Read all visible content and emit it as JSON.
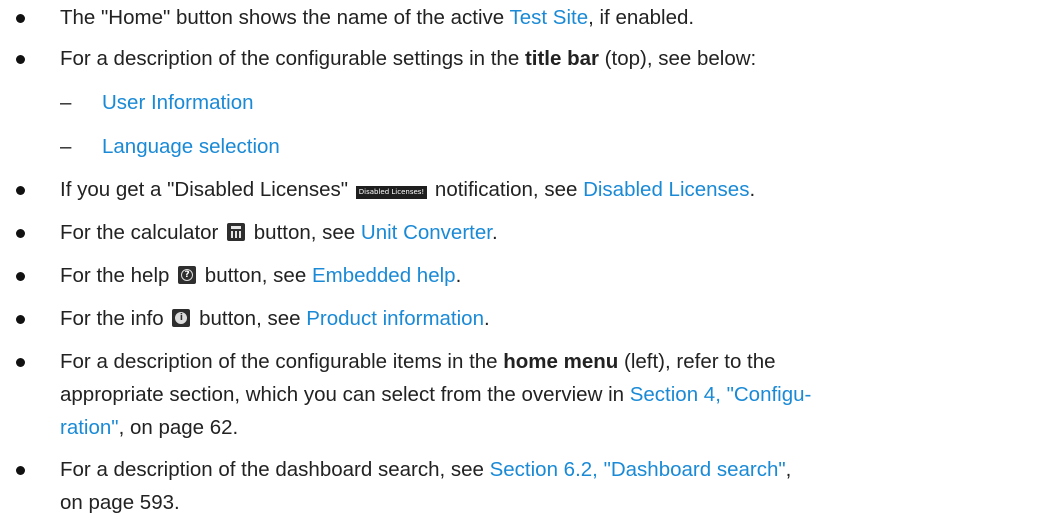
{
  "items": [
    {
      "pre": "The \"Home\" button shows the name of the active ",
      "link": "Test Site",
      "post": ", if enabled."
    },
    {
      "pre": "For a description of the configurable settings in the ",
      "bold": "title bar",
      "post": " (top), see below:"
    },
    {
      "dash": "–",
      "link": "User Information"
    },
    {
      "dash": "–",
      "link": "Language selection"
    },
    {
      "pre": "If you get a \"Disabled Licenses\" ",
      "badge": "Disabled Licenses!",
      "mid": " notification, see ",
      "link": "Disabled Licenses",
      "post": "."
    },
    {
      "pre": "For the calculator ",
      "post_icon": " button, see ",
      "link": "Unit Converter",
      "post": "."
    },
    {
      "pre": "For the help ",
      "post_icon": " button, see ",
      "link": "Embedded help",
      "post": "."
    },
    {
      "pre": "For the info ",
      "post_icon": " button, see ",
      "link": "Product information",
      "post": "."
    },
    {
      "pre": "For a description of the configurable items in the ",
      "bold": "home menu",
      "post": " (left), refer to the",
      "line2": "appropriate section, which you can select from the overview in ",
      "link_a": "Section 4, \"Configu-",
      "link_b": "ration\"",
      "post2": ", on page 62."
    },
    {
      "pre": "For a description of the dashboard search, see ",
      "link": "Section 6.2, \"Dashboard search\"",
      "post": ",",
      "line2": "on page 593."
    }
  ],
  "icons": {
    "calculator": "calculator-icon",
    "help": "help-icon",
    "info": "info-icon"
  }
}
